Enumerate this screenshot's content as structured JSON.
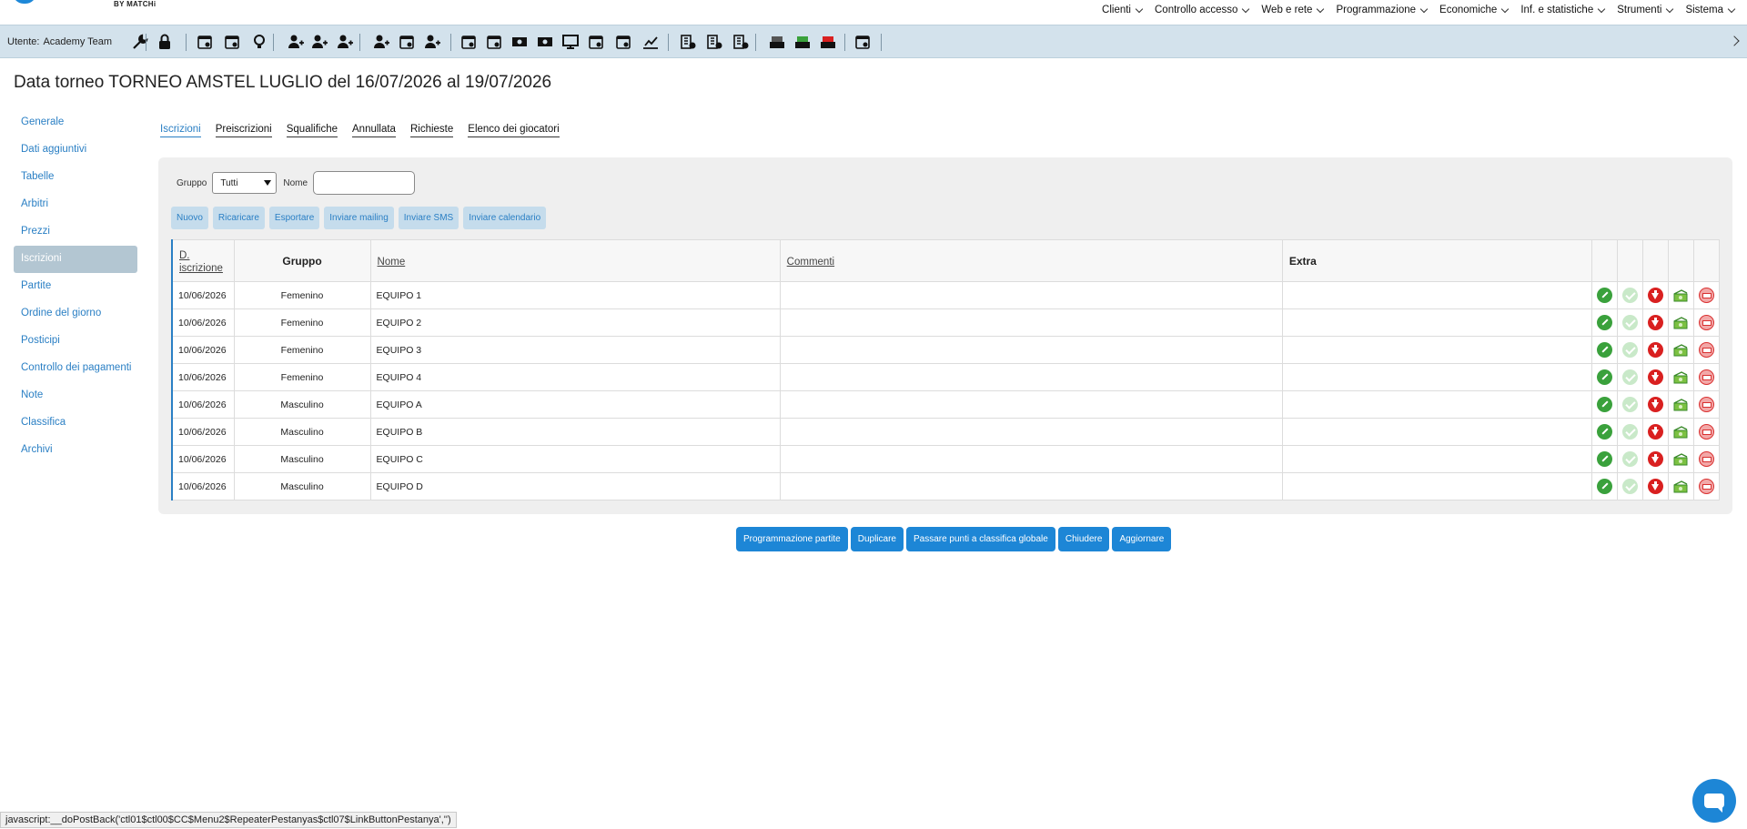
{
  "brand": {
    "sub": "BY MATCHi",
    "color": "#1e88d8"
  },
  "top_menu": [
    {
      "label": "Clienti"
    },
    {
      "label": "Controllo accesso"
    },
    {
      "label": "Web e rete"
    },
    {
      "label": "Programmazione"
    },
    {
      "label": "Economiche"
    },
    {
      "label": "Inf. e statistiche"
    },
    {
      "label": "Strumenti"
    },
    {
      "label": "Sistema"
    }
  ],
  "toolbar": {
    "user_prefix": "Utente:",
    "user_name": "Academy Team",
    "icons": [
      "wrench-icon",
      "lock-icon",
      "calendar-clock-icon",
      "calendar-icon",
      "bulb-icon",
      "add-user-icon",
      "star-user-icon",
      "check-user-icon",
      "search-user-icon",
      "search-star-icon",
      "search-users-icon",
      "card-reader-icon",
      "door-exit-icon",
      "cash-icon",
      "ticket-icon",
      "monitor-icon",
      "document-icon",
      "dollar-clock-icon",
      "chart-icon",
      "building-clock-icon",
      "building-add-icon",
      "building-money-icon",
      "register-icon",
      "register-green-icon",
      "register-red-icon",
      "archive-icon"
    ]
  },
  "page": {
    "title": "Data torneo TORNEO AMSTEL LUGLIO del 16/07/2026 al 19/07/2026"
  },
  "sidebar": {
    "items": [
      {
        "label": "Generale"
      },
      {
        "label": "Dati aggiuntivi"
      },
      {
        "label": "Tabelle"
      },
      {
        "label": "Arbitri"
      },
      {
        "label": "Prezzi"
      },
      {
        "label": "Iscrizioni",
        "active": true
      },
      {
        "label": "Partite"
      },
      {
        "label": "Ordine del giorno"
      },
      {
        "label": "Posticipi"
      },
      {
        "label": "Controllo dei pagamenti"
      },
      {
        "label": "Note"
      },
      {
        "label": "Classifica"
      },
      {
        "label": "Archivi"
      }
    ]
  },
  "tabs": [
    {
      "label": "Iscrizioni",
      "active": true
    },
    {
      "label": "Preiscrizioni"
    },
    {
      "label": "Squalifiche"
    },
    {
      "label": "Annullata"
    },
    {
      "label": "Richieste"
    },
    {
      "label": "Elenco dei giocatori"
    }
  ],
  "filters": {
    "group_label": "Gruppo",
    "group_value": "Tutti",
    "name_label": "Nome",
    "name_value": ""
  },
  "actions": [
    {
      "label": "Nuovo"
    },
    {
      "label": "Ricaricare"
    },
    {
      "label": "Esportare"
    },
    {
      "label": "Inviare mailing"
    },
    {
      "label": "Inviare SMS"
    },
    {
      "label": "Inviare calendario"
    }
  ],
  "table": {
    "headers": {
      "date": "D. iscrizione",
      "group": "Gruppo",
      "name": "Nome",
      "comments": "Commenti",
      "extra": "Extra"
    },
    "rows": [
      {
        "date": "10/06/2026",
        "group": "Femenino",
        "name": "EQUIPO 1",
        "comments": "",
        "extra": ""
      },
      {
        "date": "10/06/2026",
        "group": "Femenino",
        "name": "EQUIPO 2",
        "comments": "",
        "extra": ""
      },
      {
        "date": "10/06/2026",
        "group": "Femenino",
        "name": "EQUIPO 3",
        "comments": "",
        "extra": ""
      },
      {
        "date": "10/06/2026",
        "group": "Femenino",
        "name": "EQUIPO 4",
        "comments": "",
        "extra": ""
      },
      {
        "date": "10/06/2026",
        "group": "Masculino",
        "name": "EQUIPO A",
        "comments": "",
        "extra": ""
      },
      {
        "date": "10/06/2026",
        "group": "Masculino",
        "name": "EQUIPO B",
        "comments": "",
        "extra": ""
      },
      {
        "date": "10/06/2026",
        "group": "Masculino",
        "name": "EQUIPO C",
        "comments": "",
        "extra": ""
      },
      {
        "date": "10/06/2026",
        "group": "Masculino",
        "name": "EQUIPO D",
        "comments": "",
        "extra": ""
      }
    ]
  },
  "bottom_buttons": [
    {
      "label": "Programmazione partite"
    },
    {
      "label": "Duplicare"
    },
    {
      "label": "Passare punti a classifica globale"
    },
    {
      "label": "Chiudere"
    },
    {
      "label": "Aggiornare"
    }
  ],
  "status_bar": {
    "text": "javascript:__doPostBack('ctl01$ctl00$CC$Menu2$RepeaterPestanyas$ctl07$LinkButtonPestanya','')"
  },
  "colors": {
    "accent": "#2a7fc4",
    "button": "#1d86d6",
    "toolbar_bg": "#d3e2ec",
    "active_side": "#b3c6d2"
  }
}
